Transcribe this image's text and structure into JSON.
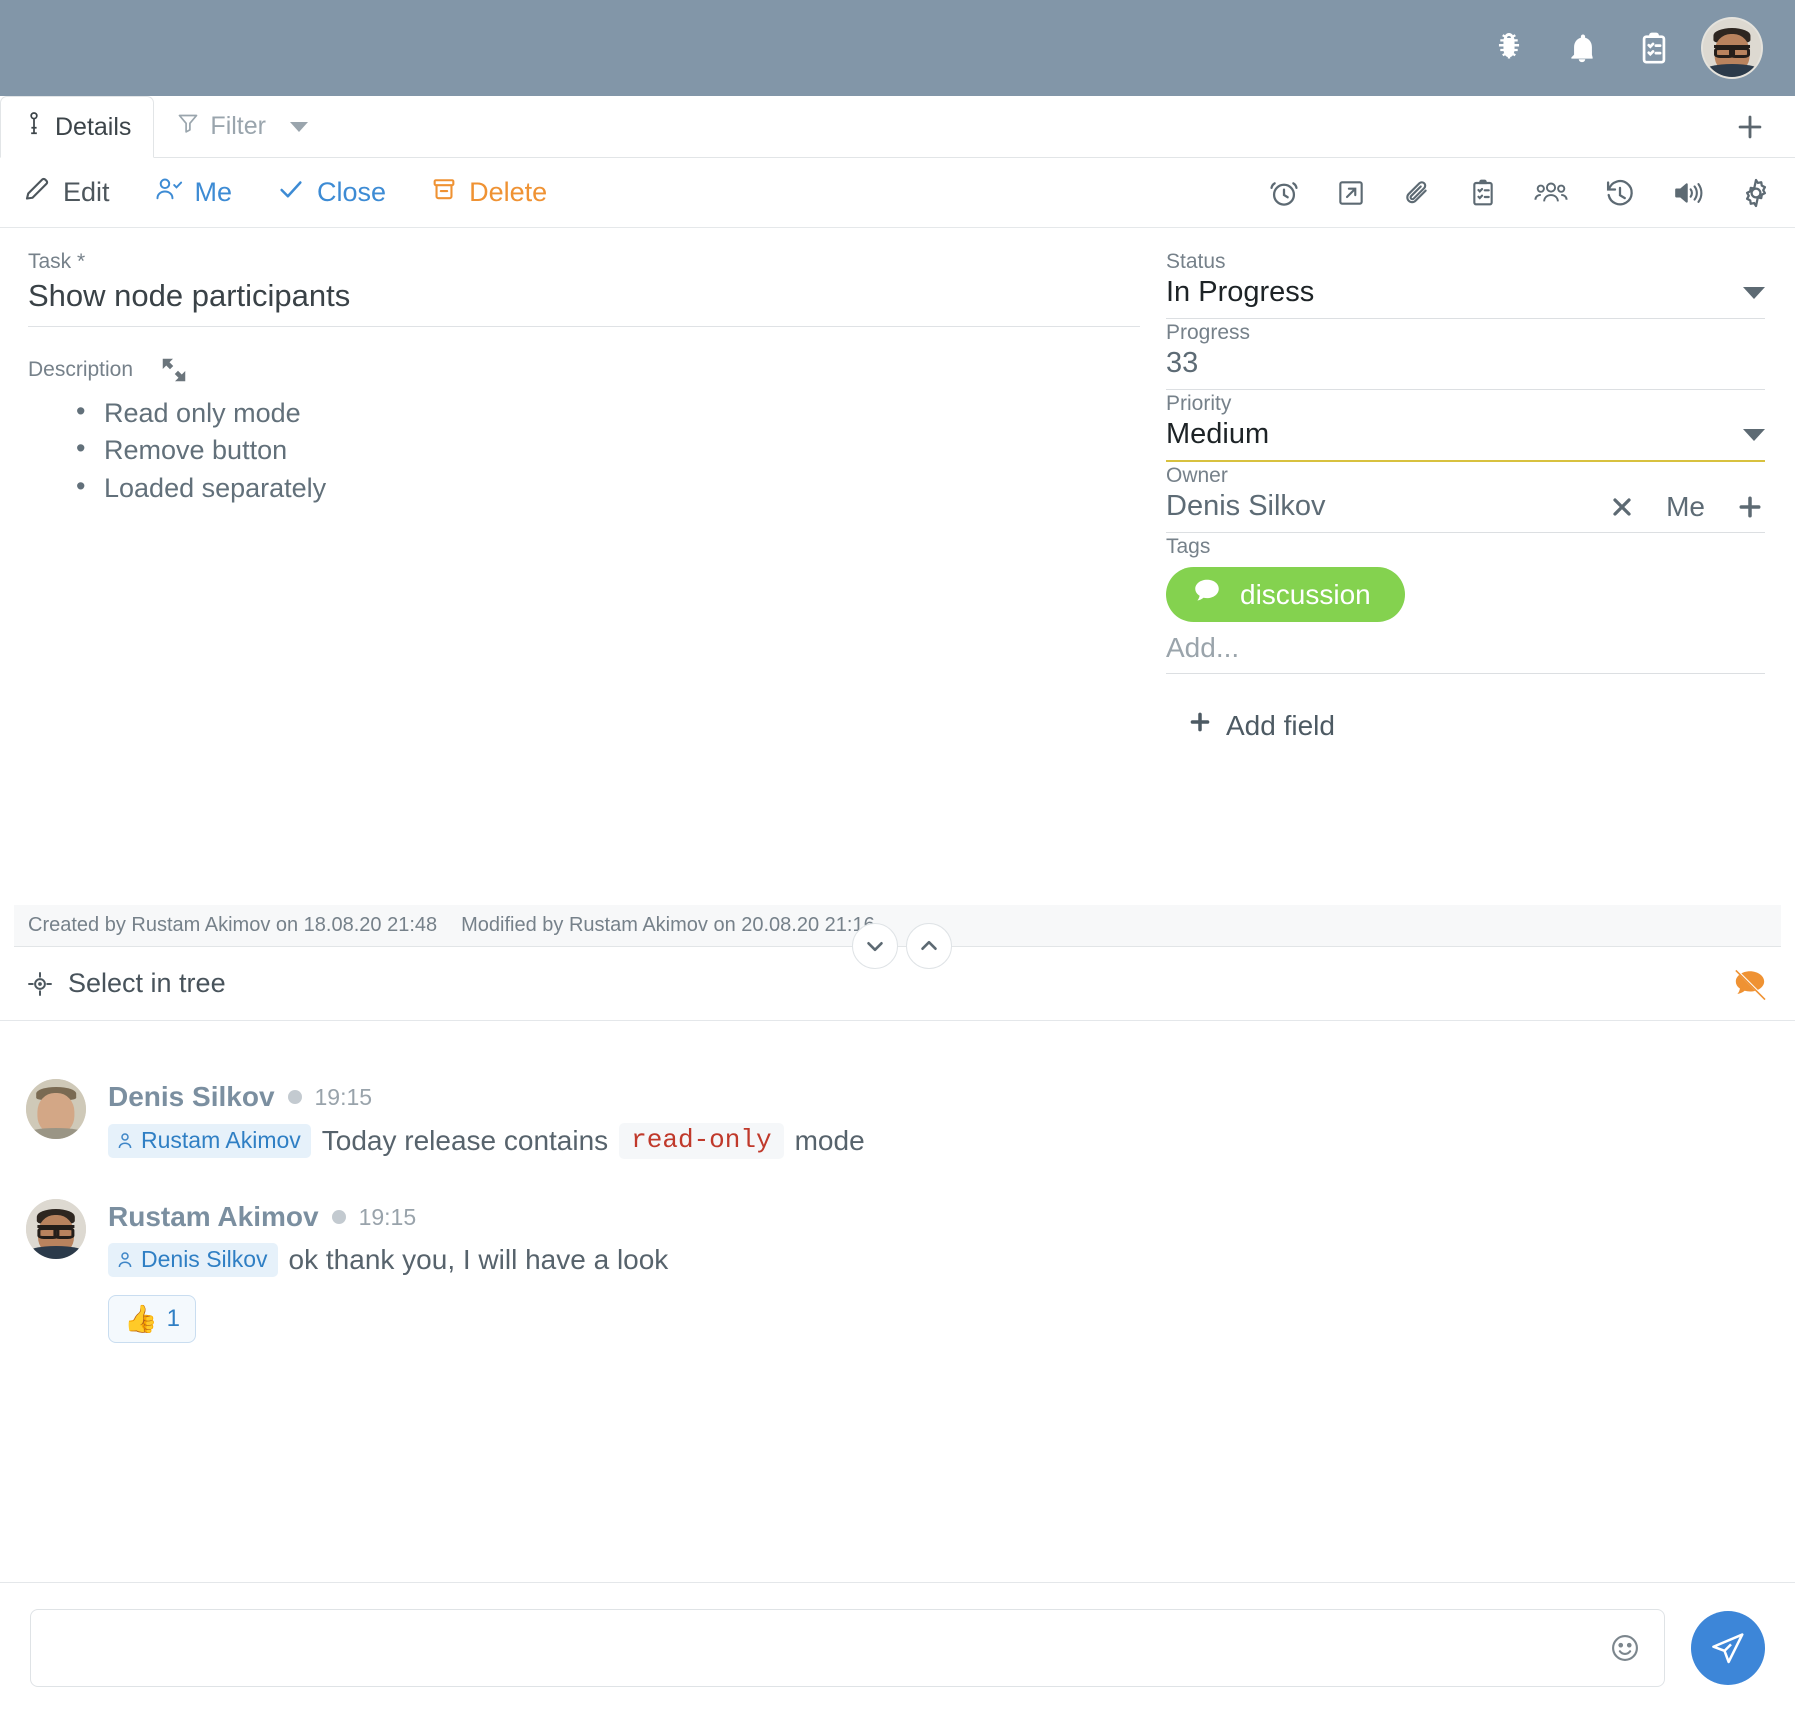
{
  "appbar": {
    "icons": [
      {
        "name": "bug-icon",
        "label": "Bugs"
      },
      {
        "name": "bell-icon",
        "label": "Notifications"
      },
      {
        "name": "clipboard-icon",
        "label": "Tasks"
      }
    ],
    "avatar_alt": "Rustam Akimov"
  },
  "tabs": {
    "details_label": "Details",
    "filter_label": "Filter",
    "add_tab_label": "+"
  },
  "toolbar": {
    "edit_label": "Edit",
    "me_label": "Me",
    "close_label": "Close",
    "delete_label": "Delete",
    "icons": [
      {
        "name": "alarm-clock-icon",
        "label": "Reminder"
      },
      {
        "name": "external-link-icon",
        "label": "Open in new"
      },
      {
        "name": "paperclip-icon",
        "label": "Attachments"
      },
      {
        "name": "clipboard-checklist-icon",
        "label": "Checklist"
      },
      {
        "name": "people-icon",
        "label": "Participants"
      },
      {
        "name": "history-icon",
        "label": "History"
      },
      {
        "name": "sound-icon",
        "label": "Sound"
      },
      {
        "name": "gear-icon",
        "label": "Settings"
      }
    ]
  },
  "task": {
    "label": "Task *",
    "title": "Show node participants",
    "description_label": "Description",
    "description_items": [
      "Read only mode",
      "Remove button",
      "Loaded separately"
    ]
  },
  "sidebar": {
    "status": {
      "label": "Status",
      "value": "In Progress"
    },
    "progress": {
      "label": "Progress",
      "value": "33"
    },
    "priority": {
      "label": "Priority",
      "value": "Medium"
    },
    "owner": {
      "label": "Owner",
      "value": "Denis Silkov",
      "me_label": "Me"
    },
    "tags": {
      "label": "Tags",
      "items": [
        {
          "text": "discussion",
          "color": "#84d24f"
        }
      ],
      "placeholder": "Add..."
    },
    "add_field_label": "Add field"
  },
  "meta": {
    "created": "Created by Rustam Akimov on 18.08.20 21:48",
    "modified": "Modified by Rustam Akimov on 20.08.20 21:16"
  },
  "tree": {
    "label": "Select in tree"
  },
  "chat": {
    "messages": [
      {
        "author": "Denis Silkov",
        "time": "19:15",
        "mention": "Rustam Akimov",
        "text_before": "Today release contains",
        "code": "read-only",
        "text_after": "mode",
        "avatar": "denis"
      },
      {
        "author": "Rustam Akimov",
        "time": "19:15",
        "mention": "Denis Silkov",
        "text_before": "ok thank you, I will have a look",
        "code": "",
        "text_after": "",
        "avatar": "rustam",
        "reaction": {
          "emoji": "👍",
          "count": "1"
        }
      }
    ]
  },
  "composer": {
    "placeholder": ""
  },
  "colors": {
    "appbar": "#8296a8",
    "accent_blue": "#3d8bd4",
    "accent_orange": "#ef9233",
    "tag_green": "#84d24f",
    "priority_underline": "#d8c13f",
    "code_red": "#c0392b"
  }
}
